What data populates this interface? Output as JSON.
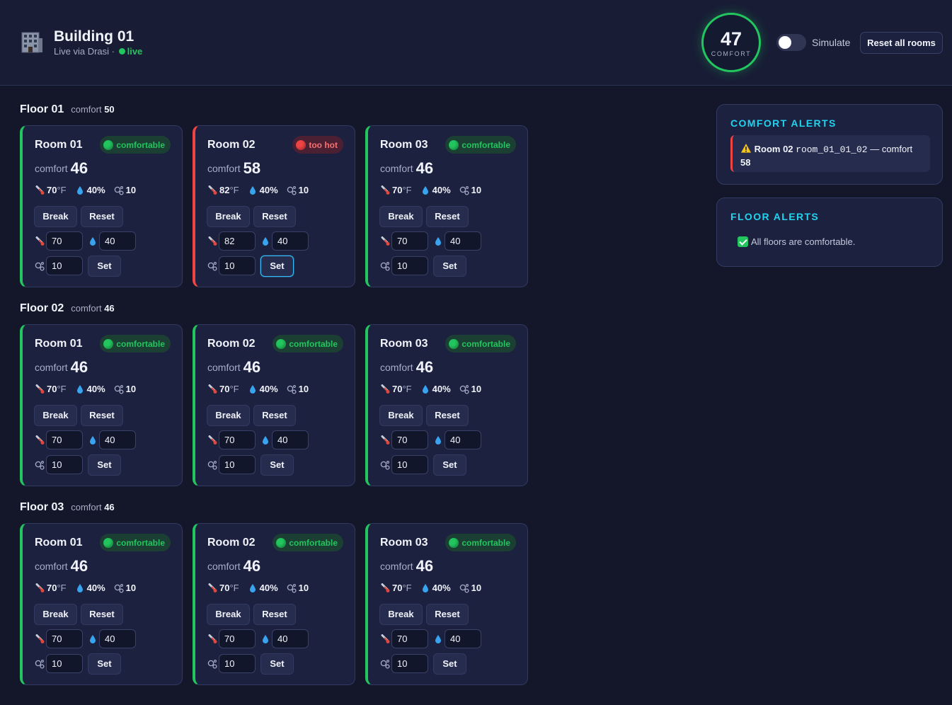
{
  "header": {
    "title": "Building 01",
    "subtitle": "Live via Drasi ·",
    "live_label": "live",
    "comfort_value": "47",
    "comfort_label": "COMFORT",
    "simulate_label": "Simulate",
    "simulate_on": false,
    "reset_all_label": "Reset all rooms"
  },
  "colors": {
    "ok": "#22c55e",
    "hot": "#ef4444",
    "accent": "#22d3ee",
    "background": "#131729",
    "card": "#1c2140"
  },
  "icons": {
    "building": "building-icon",
    "temperature": "thermometer-icon",
    "humidity": "droplet-icon",
    "co2": "co2-bubbles-icon",
    "warning": "warning-icon",
    "check": "check-icon"
  },
  "labels": {
    "comfort": "comfort",
    "break": "Break",
    "reset": "Reset",
    "set": "Set",
    "temp_unit": "°F",
    "hum_unit": "%"
  },
  "floors": [
    {
      "name": "Floor 01",
      "comfort": "50",
      "rooms": [
        {
          "name": "Room 01",
          "status": "comfortable",
          "status_type": "ok",
          "comfort": "46",
          "temp": "70",
          "humidity": "40",
          "co2": "10",
          "input_temp": "70",
          "input_humidity": "40",
          "input_co2": "10"
        },
        {
          "name": "Room 02",
          "status": "too hot",
          "status_type": "hot",
          "comfort": "58",
          "temp": "82",
          "humidity": "40",
          "co2": "10",
          "input_temp": "82",
          "input_humidity": "40",
          "input_co2": "10"
        },
        {
          "name": "Room 03",
          "status": "comfortable",
          "status_type": "ok",
          "comfort": "46",
          "temp": "70",
          "humidity": "40",
          "co2": "10",
          "input_temp": "70",
          "input_humidity": "40",
          "input_co2": "10"
        }
      ]
    },
    {
      "name": "Floor 02",
      "comfort": "46",
      "rooms": [
        {
          "name": "Room 01",
          "status": "comfortable",
          "status_type": "ok",
          "comfort": "46",
          "temp": "70",
          "humidity": "40",
          "co2": "10",
          "input_temp": "70",
          "input_humidity": "40",
          "input_co2": "10"
        },
        {
          "name": "Room 02",
          "status": "comfortable",
          "status_type": "ok",
          "comfort": "46",
          "temp": "70",
          "humidity": "40",
          "co2": "10",
          "input_temp": "70",
          "input_humidity": "40",
          "input_co2": "10"
        },
        {
          "name": "Room 03",
          "status": "comfortable",
          "status_type": "ok",
          "comfort": "46",
          "temp": "70",
          "humidity": "40",
          "co2": "10",
          "input_temp": "70",
          "input_humidity": "40",
          "input_co2": "10"
        }
      ]
    },
    {
      "name": "Floor 03",
      "comfort": "46",
      "rooms": [
        {
          "name": "Room 01",
          "status": "comfortable",
          "status_type": "ok",
          "comfort": "46",
          "temp": "70",
          "humidity": "40",
          "co2": "10",
          "input_temp": "70",
          "input_humidity": "40",
          "input_co2": "10"
        },
        {
          "name": "Room 02",
          "status": "comfortable",
          "status_type": "ok",
          "comfort": "46",
          "temp": "70",
          "humidity": "40",
          "co2": "10",
          "input_temp": "70",
          "input_humidity": "40",
          "input_co2": "10"
        },
        {
          "name": "Room 03",
          "status": "comfortable",
          "status_type": "ok",
          "comfort": "46",
          "temp": "70",
          "humidity": "40",
          "co2": "10",
          "input_temp": "70",
          "input_humidity": "40",
          "input_co2": "10"
        }
      ]
    }
  ],
  "comfort_alerts": {
    "title": "COMFORT ALERTS",
    "items": [
      {
        "room": "Room 02",
        "room_id": "room_01_01_02",
        "text": "— comfort",
        "value": "58"
      }
    ]
  },
  "floor_alerts": {
    "title": "FLOOR ALERTS",
    "message": "All floors are comfortable."
  }
}
